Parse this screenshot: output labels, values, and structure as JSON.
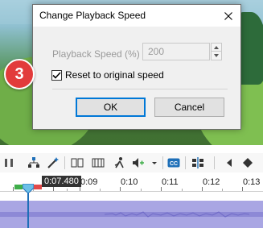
{
  "dialog": {
    "title": "Change Playback Speed",
    "speed_label": "Playback Speed (%)",
    "speed_value": "200",
    "checkbox_label": "Reset to original speed",
    "checkbox_checked": true,
    "ok_label": "OK",
    "cancel_label": "Cancel"
  },
  "step_badge": "3",
  "timeline": {
    "current_time": "0:07.480",
    "ticks": [
      "0:09",
      "0:10",
      "0:11",
      "0:12",
      "0:13"
    ]
  },
  "colors": {
    "badge": "#e23b3b",
    "ok_border": "#0078d7",
    "audio_track": "#a9a6e3",
    "playhead": "#1e6fb8"
  }
}
